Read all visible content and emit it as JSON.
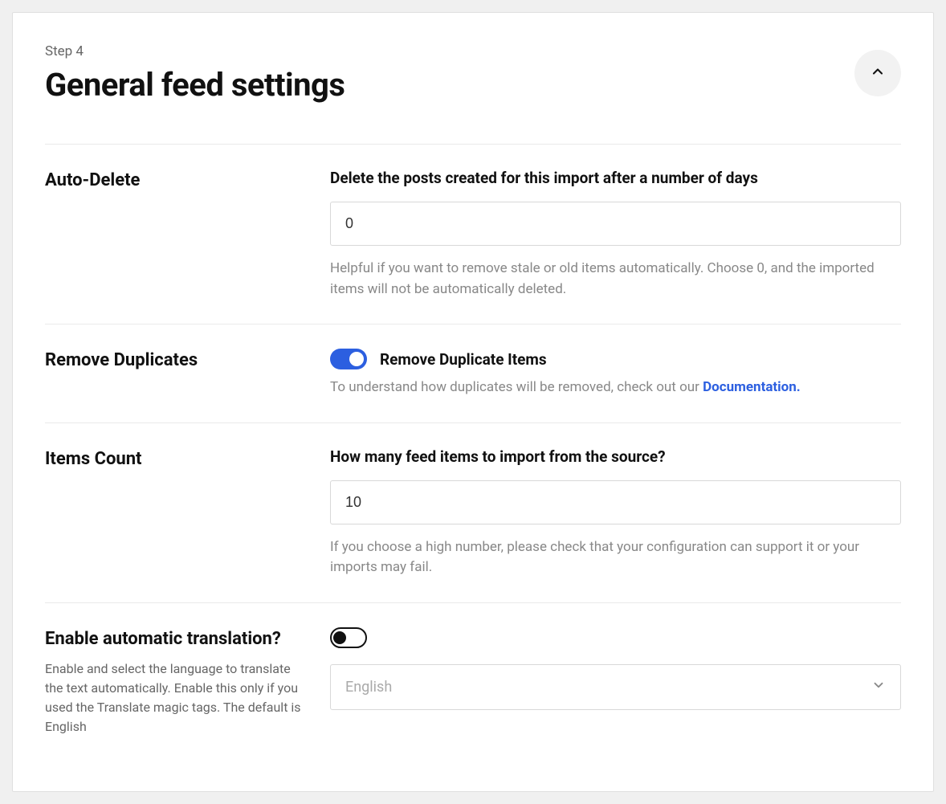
{
  "header": {
    "step": "Step 4",
    "title": "General feed settings"
  },
  "settings": {
    "autoDelete": {
      "label": "Auto-Delete",
      "fieldTitle": "Delete the posts created for this import after a number of days",
      "value": "0",
      "help": "Helpful if you want to remove stale or old items automatically. Choose 0, and the imported items will not be automatically deleted."
    },
    "removeDuplicates": {
      "label": "Remove Duplicates",
      "toggleLabel": "Remove Duplicate Items",
      "helpPrefix": "To understand how duplicates will be removed, check out our ",
      "linkText": "Documentation."
    },
    "itemsCount": {
      "label": "Items Count",
      "fieldTitle": "How many feed items to import from the source?",
      "value": "10",
      "help": "If you choose a high number, please check that your configuration can support it or your imports may fail."
    },
    "translation": {
      "label": "Enable automatic translation?",
      "sublabel": "Enable and select the language to translate the text automatically. Enable this only if you used the Translate magic tags. The default is English",
      "selectedLanguage": "English"
    }
  }
}
